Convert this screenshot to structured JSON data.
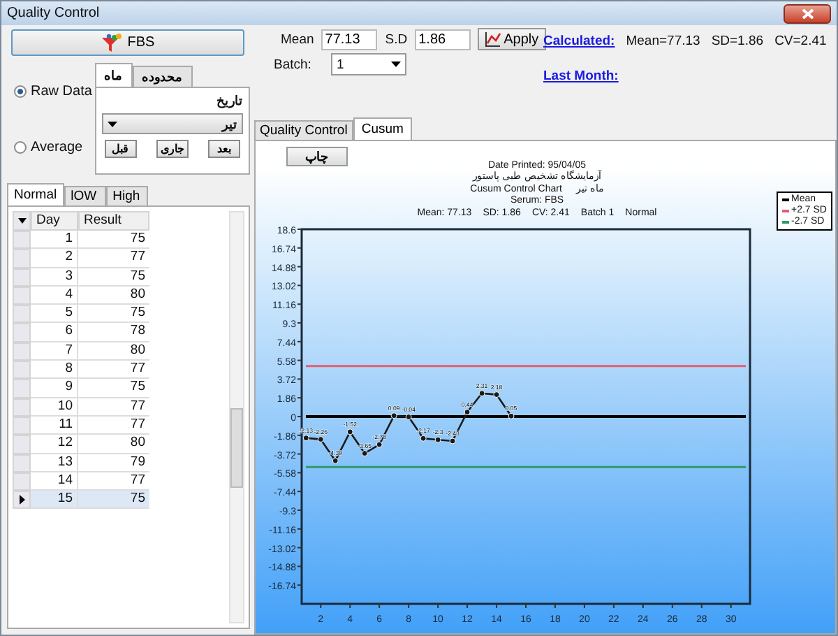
{
  "window": {
    "title": "Quality Control"
  },
  "test_button": {
    "label": "FBS"
  },
  "data_mode": [
    {
      "label": "Raw Data",
      "selected": true
    },
    {
      "label": "Average",
      "selected": false
    }
  ],
  "period_tabs": [
    {
      "label": "ماه",
      "selected": true
    },
    {
      "label": "محدوده",
      "selected": false
    }
  ],
  "period_panel": {
    "label": "تاریخ",
    "month": "تیر",
    "buttons": [
      "بعد",
      "جاری",
      "قبل"
    ]
  },
  "level_tabs": [
    {
      "label": "Normal",
      "selected": true
    },
    {
      "label": "lOW",
      "selected": false
    },
    {
      "label": "High",
      "selected": false
    }
  ],
  "table": {
    "columns": [
      "Day",
      "Result"
    ],
    "rows": [
      {
        "day": "1",
        "result": "75",
        "selected": false
      },
      {
        "day": "2",
        "result": "77",
        "selected": false
      },
      {
        "day": "3",
        "result": "75",
        "selected": false
      },
      {
        "day": "4",
        "result": "80",
        "selected": false
      },
      {
        "day": "5",
        "result": "75",
        "selected": false
      },
      {
        "day": "6",
        "result": "78",
        "selected": false
      },
      {
        "day": "7",
        "result": "80",
        "selected": false
      },
      {
        "day": "8",
        "result": "77",
        "selected": false
      },
      {
        "day": "9",
        "result": "75",
        "selected": false
      },
      {
        "day": "10",
        "result": "77",
        "selected": false
      },
      {
        "day": "11",
        "result": "77",
        "selected": false
      },
      {
        "day": "12",
        "result": "80",
        "selected": false
      },
      {
        "day": "13",
        "result": "79",
        "selected": false
      },
      {
        "day": "14",
        "result": "77",
        "selected": false
      },
      {
        "day": "15",
        "result": "75",
        "selected": true
      }
    ]
  },
  "settings": {
    "mean_label": "Mean",
    "mean": "77.13",
    "sd_label": "S.D",
    "sd": "1.86",
    "batch_label": "Batch:",
    "batch": "1",
    "apply": "Apply"
  },
  "calculated": {
    "link": "Calculated:",
    "mean": "Mean=77.13",
    "sd": "SD=1.86",
    "cv": "CV=2.41"
  },
  "last_month": {
    "link": "Last Month:"
  },
  "view_tabs": [
    {
      "label": "Quality Control",
      "selected": false
    },
    {
      "label": "Cusum",
      "selected": true
    }
  ],
  "cusum": {
    "print": "چاپ",
    "date": "Date Printed: 95/04/05",
    "lab": "آزمایشگاه تشخیص طبی پاستور",
    "chart_title": "Cusum Control Chart",
    "month": "ماه تیر",
    "serum": "Serum: FBS",
    "summary": [
      "Mean: 77.13",
      "SD: 1.86",
      "CV: 2.41",
      "Batch 1",
      "Normal"
    ],
    "chart_data": {
      "type": "line",
      "x": [
        1,
        2,
        3,
        4,
        5,
        6,
        7,
        8,
        9,
        10,
        11,
        12,
        13,
        14,
        15
      ],
      "series": [
        {
          "color": "#1a1a1a",
          "marker": "circle",
          "values": [
            -2.13,
            -2.26,
            -4.39,
            -1.52,
            -3.65,
            -2.78,
            0.09,
            -0.04,
            -2.17,
            -2.3,
            -2.43,
            0.44,
            2.31,
            2.18,
            0.05
          ]
        }
      ],
      "value_labels": [
        "-2.13",
        "-2.26",
        "-4.39",
        "-1.52",
        "-3.65",
        "-2.78",
        "0.09",
        "-0.04",
        "-2.17",
        "-2.3",
        "-2.43",
        "0.44",
        "2.31",
        "2.18",
        "0.05"
      ],
      "xlim": [
        0.7,
        31.3
      ],
      "ylim": [
        -18.6,
        18.6
      ],
      "xticks": [
        2,
        4,
        6,
        8,
        10,
        12,
        14,
        16,
        18,
        20,
        22,
        24,
        26,
        28,
        30
      ],
      "yticks": [
        18.6,
        16.74,
        14.88,
        13.02,
        11.16,
        9.3,
        7.44,
        5.58,
        3.72,
        1.86,
        0,
        -1.86,
        -3.72,
        -5.58,
        -7.44,
        -9.3,
        -11.16,
        -13.02,
        -14.88,
        -16.74
      ],
      "ref_lines": [
        {
          "axis": "y",
          "value": 0,
          "label": "Mean",
          "color": "#000000"
        },
        {
          "axis": "y",
          "value": 5.02,
          "label": "+2.7 SD",
          "color": "#e06070"
        },
        {
          "axis": "y",
          "value": -5.02,
          "label": "-2.7 SD",
          "color": "#2e9a6a"
        }
      ]
    }
  }
}
